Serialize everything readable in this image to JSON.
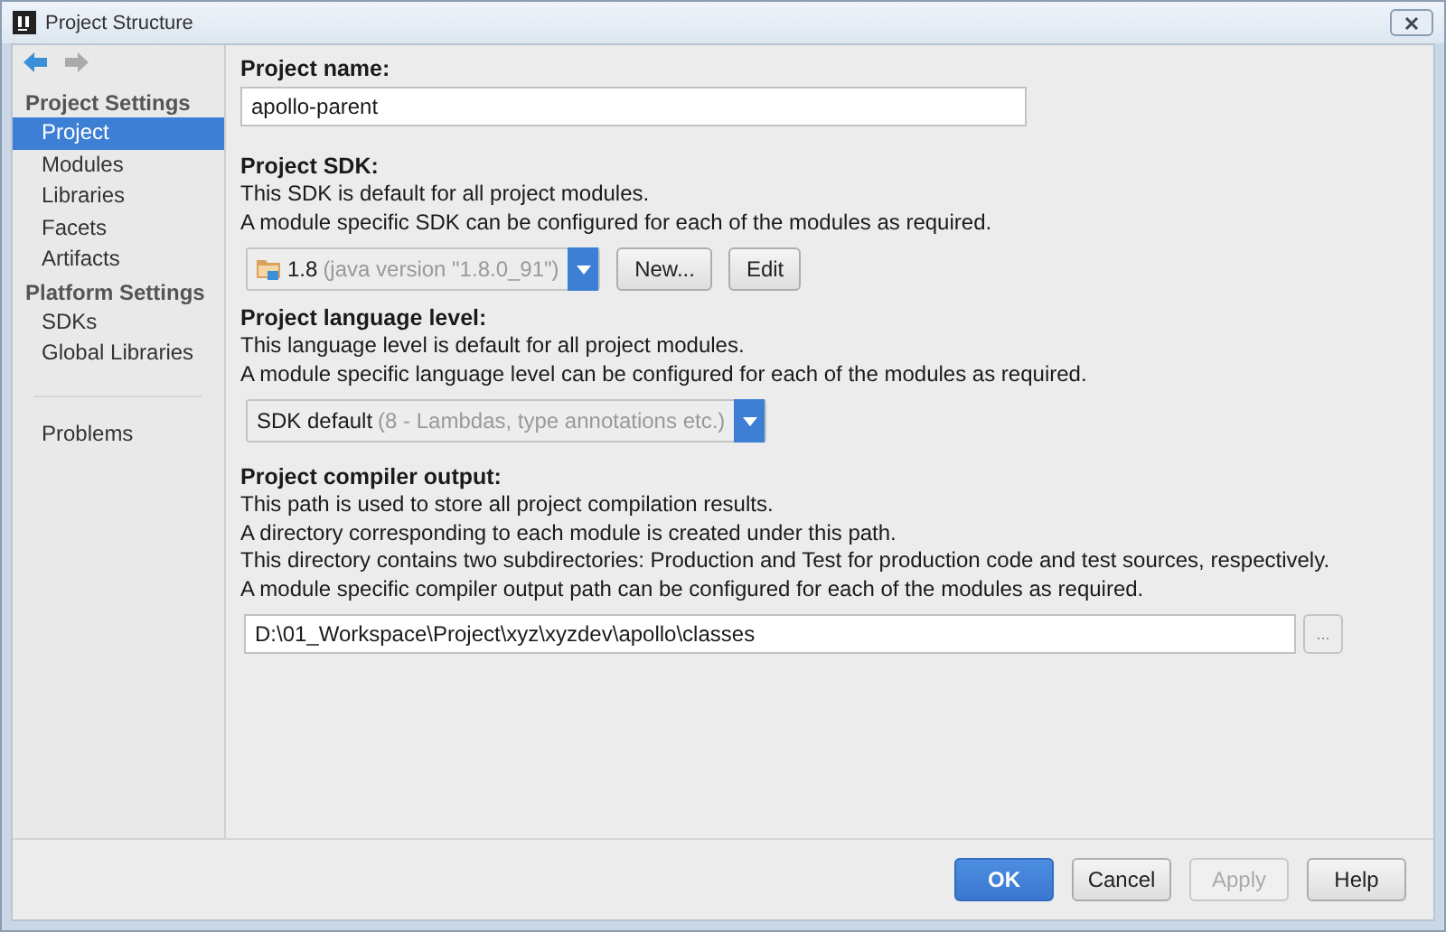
{
  "window": {
    "title": "Project Structure"
  },
  "sidebar": {
    "sections": [
      {
        "heading": "Project Settings",
        "items": [
          {
            "label": "Project",
            "selected": true
          },
          {
            "label": "Modules",
            "selected": false
          },
          {
            "label": "Libraries",
            "selected": false
          },
          {
            "label": "Facets",
            "selected": false
          },
          {
            "label": "Artifacts",
            "selected": false
          }
        ]
      },
      {
        "heading": "Platform Settings",
        "items": [
          {
            "label": "SDKs",
            "selected": false
          },
          {
            "label": "Global Libraries",
            "selected": false
          }
        ]
      }
    ],
    "extra_items": [
      {
        "label": "Problems",
        "selected": false
      }
    ]
  },
  "project_name": {
    "label": "Project name:",
    "value": "apollo-parent"
  },
  "project_sdk": {
    "label": "Project SDK:",
    "lines": [
      "This SDK is default for all project modules.",
      "A module specific SDK can be configured for each of the modules as required."
    ],
    "select": {
      "value": "1.8",
      "detail": "(java version \"1.8.0_91\")"
    },
    "buttons": [
      {
        "label": "New...",
        "disabled": false
      },
      {
        "label": "Edit",
        "disabled": false
      }
    ]
  },
  "language_level": {
    "label": "Project language level:",
    "lines": [
      "This language level is default for all project modules.",
      "A module specific language level can be configured for each of the modules as required."
    ],
    "select": {
      "value": "SDK default",
      "detail": "(8 - Lambdas, type annotations etc.)"
    }
  },
  "compiler_output": {
    "label": "Project compiler output:",
    "lines": [
      "This path is used to store all project compilation results.",
      "A directory corresponding to each module is created under this path.",
      "This directory contains two subdirectories: Production and Test for production code and test sources, respectively.",
      "A module specific compiler output path can be configured for each of the modules as required."
    ],
    "value": "D:\\01_Workspace\\Project\\xyz\\xyzdev\\apollo\\classes",
    "browse": "..."
  },
  "buttons": [
    {
      "label": "OK",
      "kind": "primary",
      "disabled": false
    },
    {
      "label": "Cancel",
      "kind": "normal",
      "disabled": false
    },
    {
      "label": "Apply",
      "kind": "normal",
      "disabled": true
    },
    {
      "label": "Help",
      "kind": "normal",
      "disabled": false
    }
  ]
}
